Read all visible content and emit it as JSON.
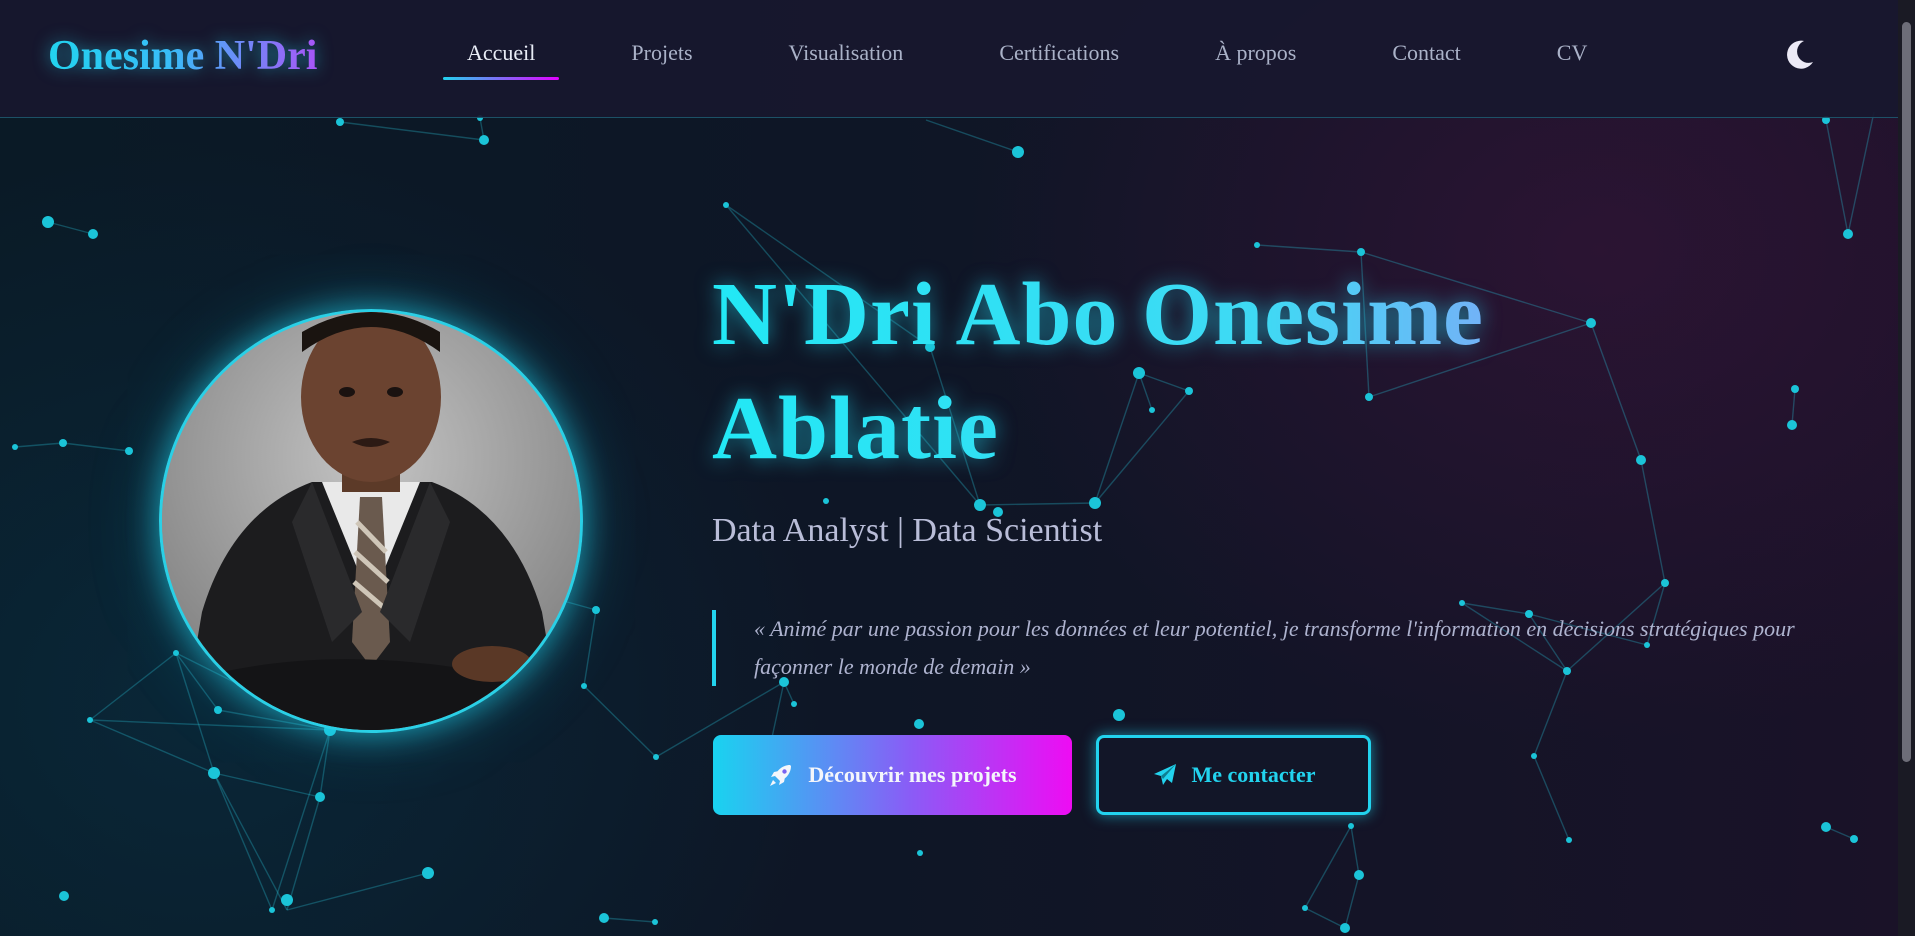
{
  "brand": "Onesime N'Dri",
  "nav": {
    "items": [
      {
        "label": "Accueil",
        "active": true
      },
      {
        "label": "Projets",
        "active": false
      },
      {
        "label": "Visualisation",
        "active": false
      },
      {
        "label": "Certifications",
        "active": false
      },
      {
        "label": "À propos",
        "active": false
      },
      {
        "label": "Contact",
        "active": false
      },
      {
        "label": "CV",
        "active": false
      }
    ],
    "theme_toggle_icon": "moon-icon"
  },
  "hero": {
    "name": "N'Dri Abo Onesime Ablatie",
    "role": "Data Analyst | Data Scientist",
    "quote": "« Animé par une passion pour les données et leur potentiel, je transforme l'information en décisions stratégiques pour façonner le monde de demain »",
    "primary_button": {
      "label": "Découvrir mes projets",
      "icon": "rocket-icon"
    },
    "secondary_button": {
      "label": "Me contacter",
      "icon": "paper-plane-icon"
    }
  },
  "colors": {
    "accent_cyan": "#22d3ee",
    "accent_magenta": "#ee0cf3",
    "accent_violet": "#a855f7",
    "nav_background": "#18182e"
  }
}
